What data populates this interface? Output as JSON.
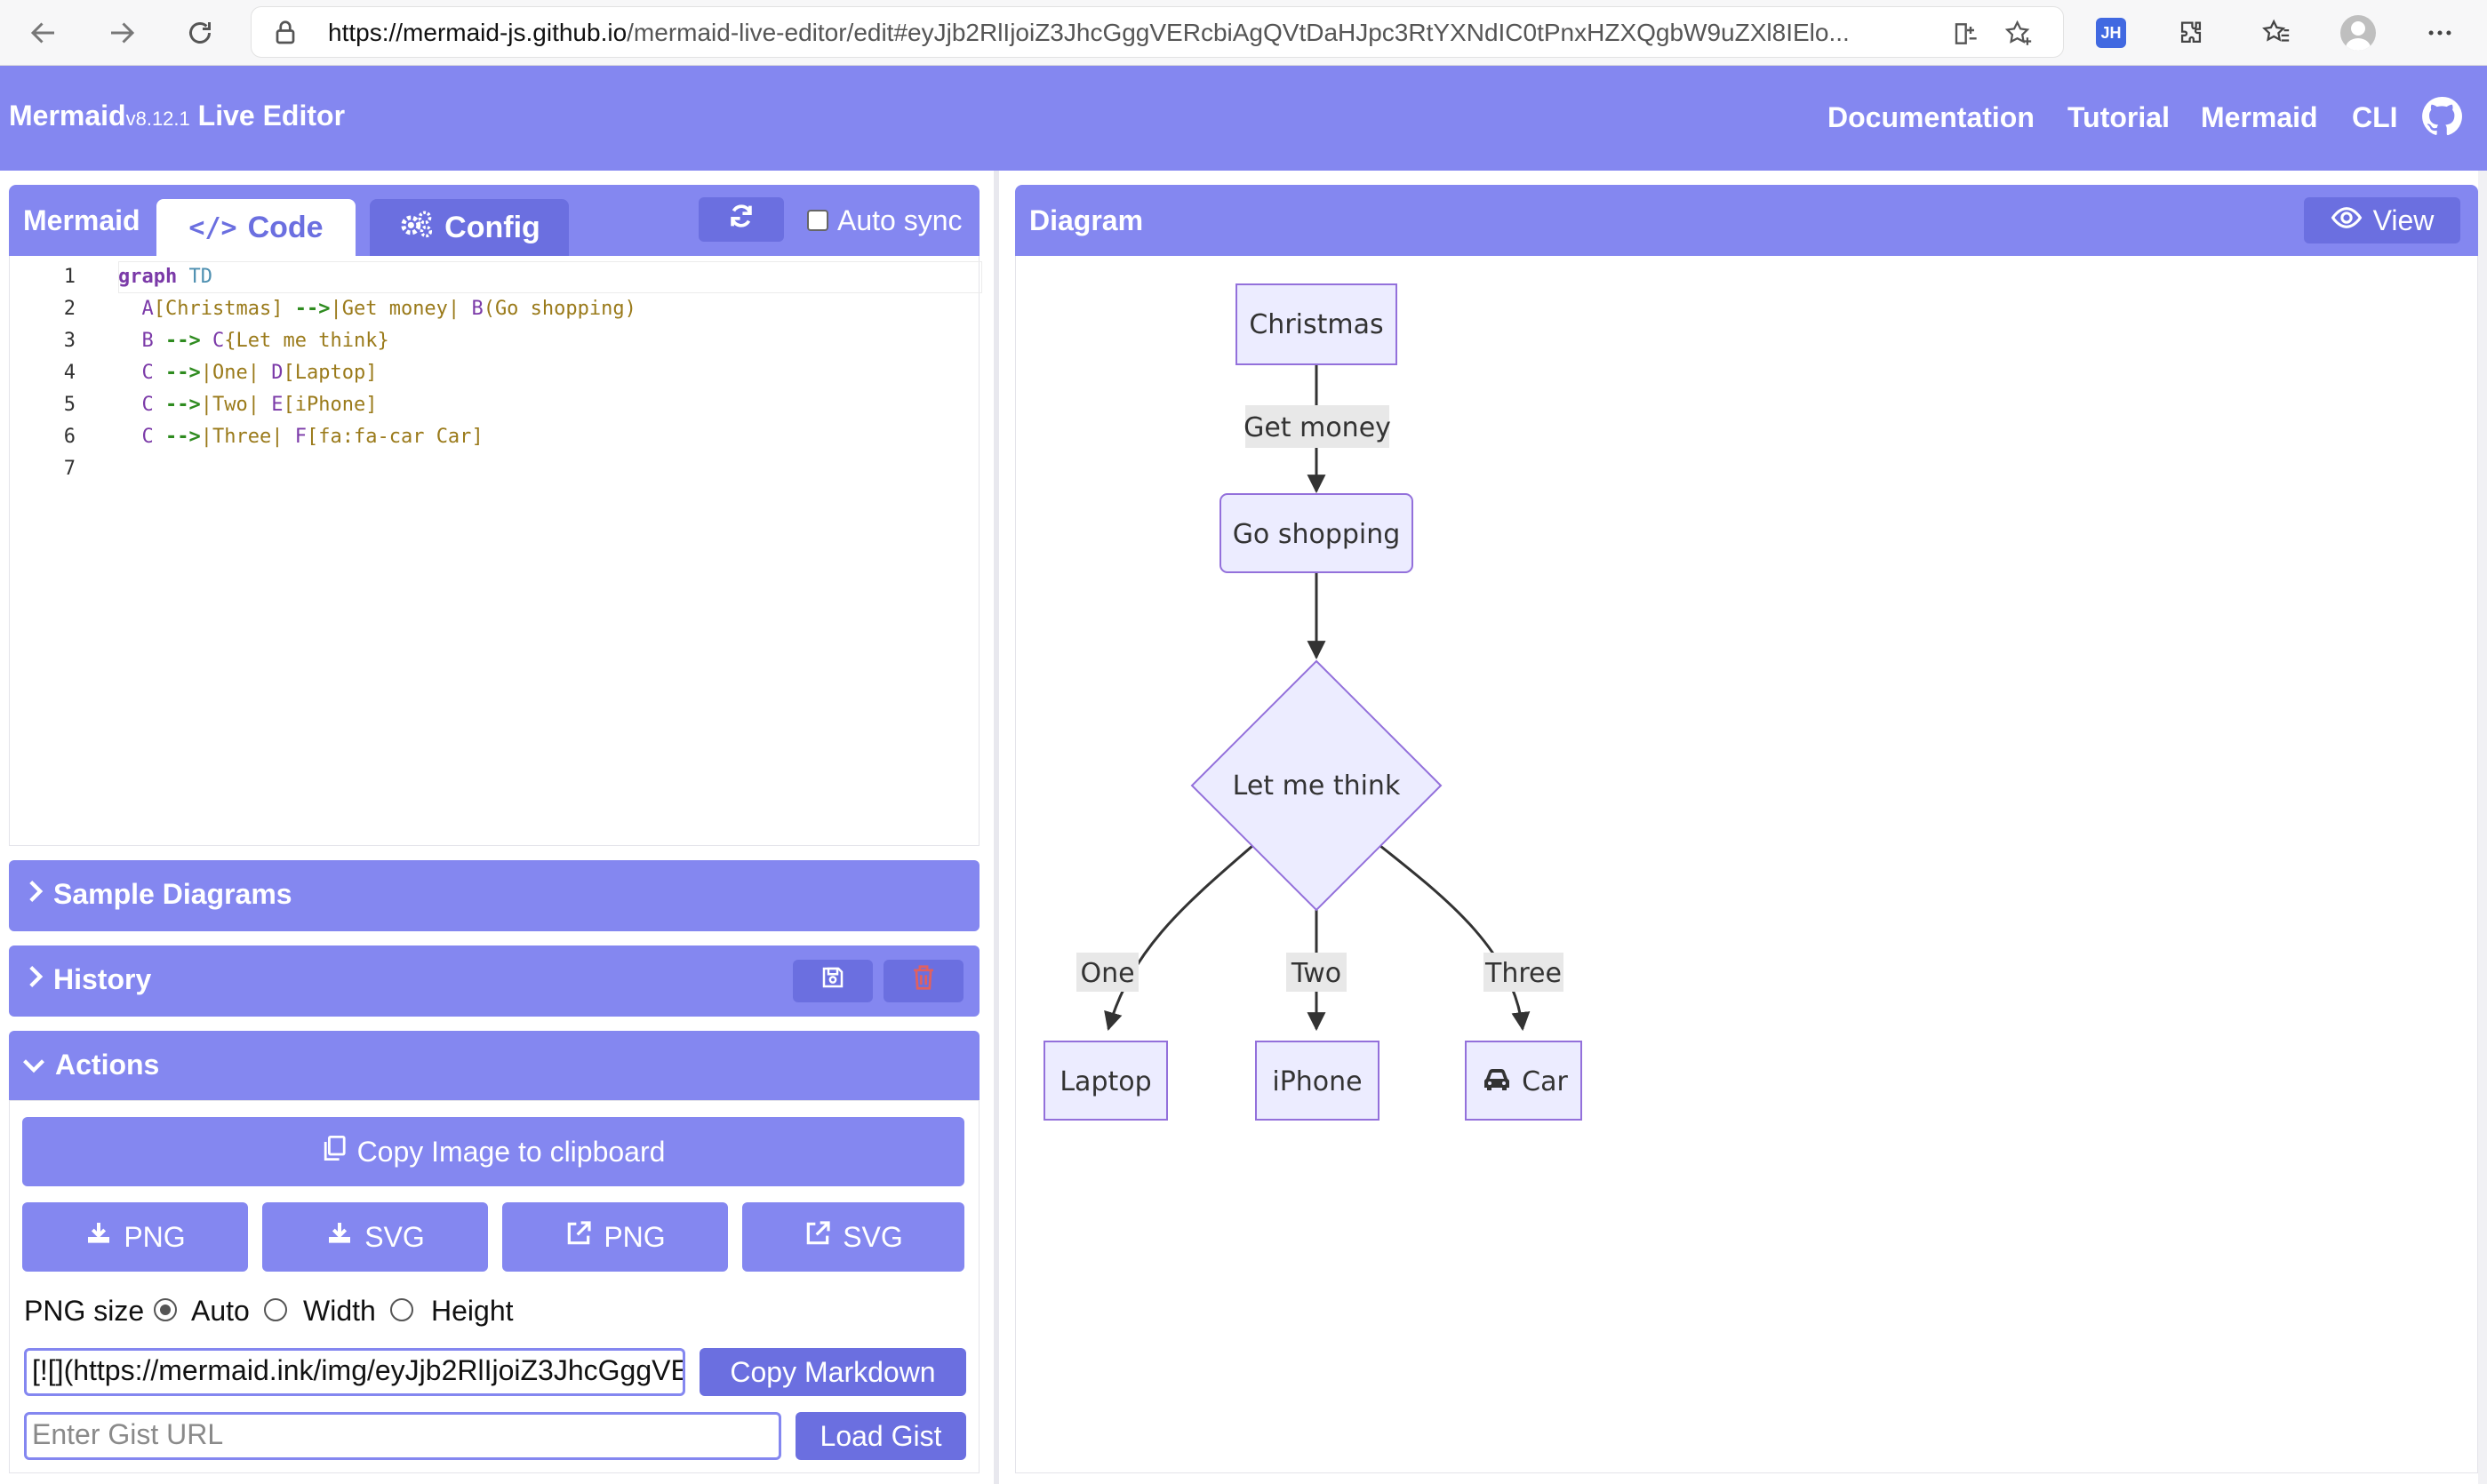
{
  "browser": {
    "url_host": "https://mermaid-js.github.io",
    "url_path": "/mermaid-live-editor/edit#eyJjb2RlIjoiZ3JhcGggVERcbiAgQVtDaHJpc3RtYXNdIC0tPnxHZXQgbW9uZXl8IElo...",
    "ext_badge": "JH"
  },
  "header": {
    "brand": "Mermaid",
    "version": "v8.12.1",
    "subtitle": " Live Editor",
    "links": [
      "Documentation",
      "Tutorial",
      "Mermaid",
      "CLI"
    ]
  },
  "editor_panel": {
    "title": "Mermaid",
    "tab_code": "Code",
    "tab_config": "Config",
    "auto_sync": "Auto sync",
    "line_numbers": [
      "1",
      "2",
      "3",
      "4",
      "5",
      "6",
      "7"
    ]
  },
  "accordions": {
    "samples": "Sample Diagrams",
    "history": "History",
    "actions": "Actions"
  },
  "actions": {
    "copy_image": "Copy Image to clipboard",
    "png_download": "PNG",
    "svg_download": "SVG",
    "png_link": "PNG",
    "svg_link": "SVG",
    "png_size_label": "PNG size",
    "auto": "Auto",
    "width": "Width",
    "height": "Height",
    "markdown_value": "[![](https://mermaid.ink/img/eyJjb2RlIjoiZ3JhcGggVERcbiAgQVtDaHJpc3RtYXNd",
    "copy_markdown": "Copy Markdown",
    "gist_placeholder": "Enter Gist URL",
    "load_gist": "Load Gist"
  },
  "diagram_panel": {
    "title": "Diagram",
    "view_button": "View"
  },
  "diagram": {
    "nodes": {
      "christmas": "Christmas",
      "go_shopping": "Go shopping",
      "let_me_think": "Let me think",
      "laptop": "Laptop",
      "iphone": "iPhone",
      "car": "Car"
    },
    "edges": {
      "get_money": "Get money",
      "one": "One",
      "two": "Two",
      "three": "Three"
    }
  },
  "colors": {
    "accent": "#8487f0",
    "accent_dark": "#6b6fe0",
    "node_fill": "#ececff",
    "node_stroke": "#9370db",
    "trash": "#e06060"
  }
}
